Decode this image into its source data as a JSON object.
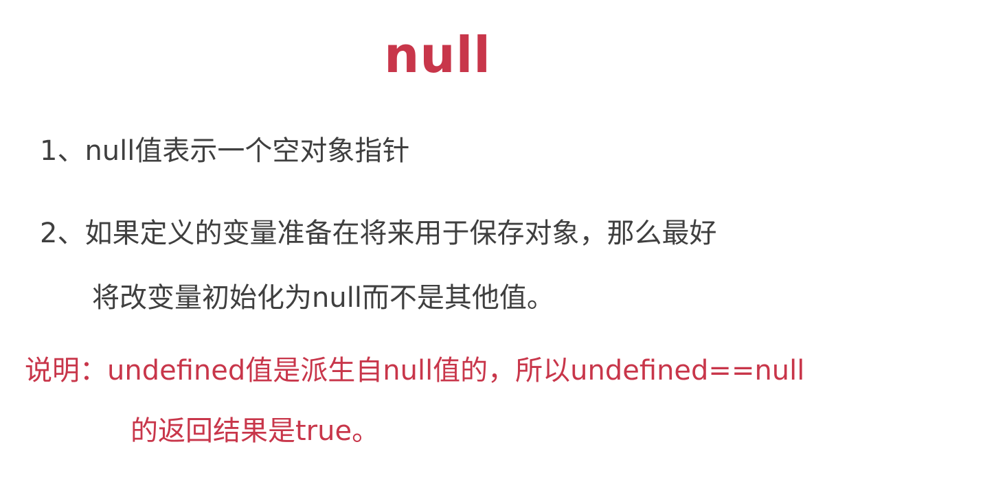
{
  "slide": {
    "title": "null",
    "points": [
      "1、null值表示一个空对象指针",
      "2、如果定义的变量准备在将来用于保存对象，那么最好",
      "将改变量初始化为null而不是其他值。"
    ],
    "note": [
      "说明：undefined值是派生自null值的，所以undefined==null",
      "的返回结果是true。"
    ],
    "colors": {
      "accent": "#c8364a",
      "body_text": "#3f3f3f",
      "background": "#ffffff"
    }
  }
}
